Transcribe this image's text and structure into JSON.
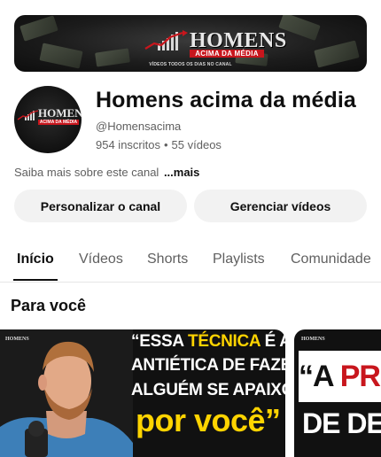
{
  "banner": {
    "logo_text": "HOMENS",
    "logo_sub": "ACIMA DA MÉDIA",
    "tagline": "VÍDEOS TODOS OS DIAS NO CANAL"
  },
  "avatar": {
    "logo_text": "HOMENS",
    "logo_sub": "ACIMA DA MÉDIA"
  },
  "channel": {
    "name": "Homens acima da média",
    "handle": "@Homensacima",
    "subscribers": "954 inscritos",
    "videos": "55 vídeos",
    "separator": "•",
    "about": "Saiba mais sobre este canal",
    "about_more": "...mais"
  },
  "actions": {
    "customize": "Personalizar o canal",
    "manage": "Gerenciar vídeos"
  },
  "tabs": [
    {
      "label": "Início",
      "active": true
    },
    {
      "label": "Vídeos",
      "active": false
    },
    {
      "label": "Shorts",
      "active": false
    },
    {
      "label": "Playlists",
      "active": false
    },
    {
      "label": "Comunidade",
      "active": false
    }
  ],
  "section": {
    "title": "Para você"
  },
  "thumbnails": [
    {
      "logo": "HOMENS",
      "line1_a": "“ESSA ",
      "line1_highlight": "TÉCNICA",
      "line1_b": " É A MAIS",
      "line2": "ANTIÉTICA DE FAZER",
      "line3": "ALGUÉM SE APAIXONAR",
      "line4": "por você”"
    },
    {
      "logo": "HOMENS",
      "line1_a": "“A ",
      "line1_red": "PRESSA",
      "line2": "DE DEUS”"
    }
  ],
  "colors": {
    "accent_red": "#c8161d",
    "highlight_yellow": "#ffd400",
    "button_bg": "#f2f2f2",
    "secondary_text": "#606060"
  }
}
